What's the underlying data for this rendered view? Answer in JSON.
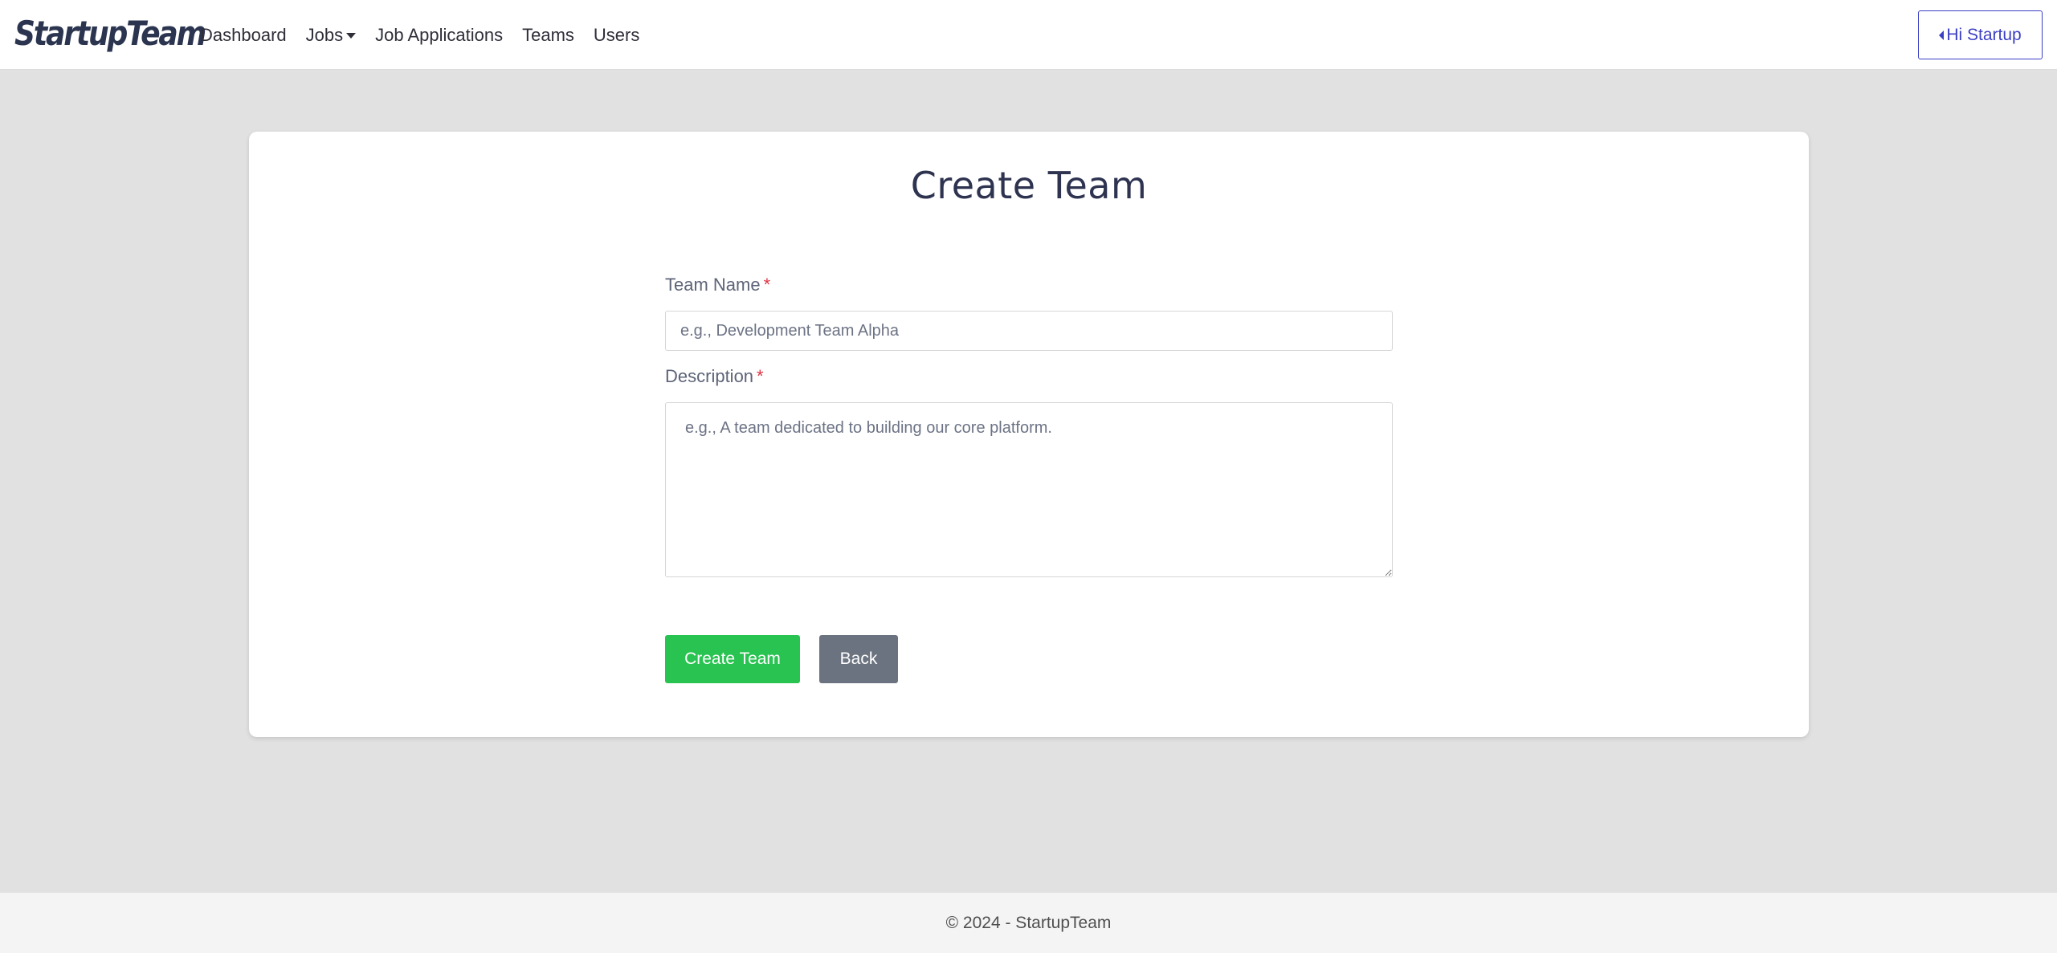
{
  "nav": {
    "brand": "StartupTeam",
    "links": {
      "dashboard": "Dashboard",
      "jobs": "Jobs",
      "job_applications": "Job Applications",
      "teams": "Teams",
      "users": "Users"
    },
    "user_button": "Hi Startup"
  },
  "form": {
    "title": "Create Team",
    "team_name_label": "Team Name",
    "team_name_placeholder": "e.g., Development Team Alpha",
    "team_name_value": "",
    "description_label": "Description",
    "description_placeholder": "e.g., A team dedicated to building our core platform.",
    "description_value": "",
    "required_marker": "*",
    "submit_label": "Create Team",
    "back_label": "Back"
  },
  "footer": {
    "text": "© 2024 - StartupTeam"
  },
  "colors": {
    "accent": "#3b3fc4",
    "success": "#28c351",
    "secondary": "#6c7380",
    "required": "#dc3545"
  }
}
